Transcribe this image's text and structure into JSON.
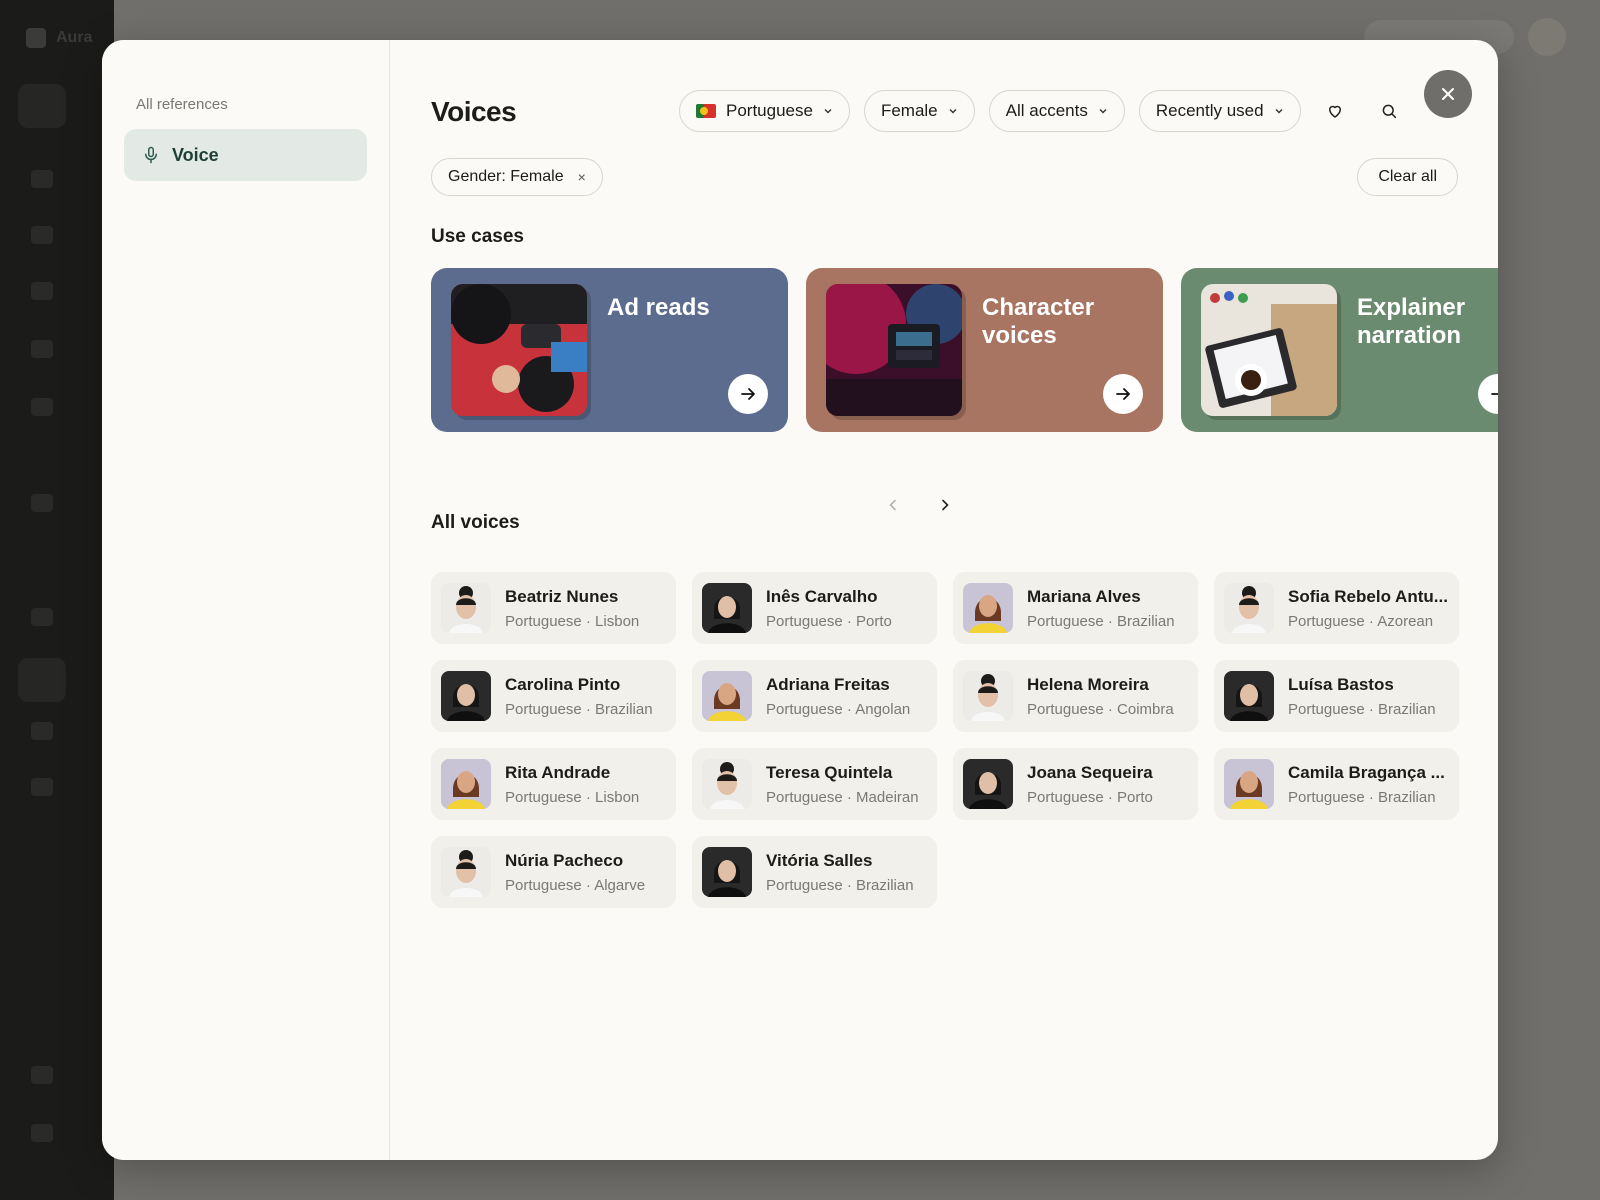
{
  "background": {
    "app_name": "Aura"
  },
  "sidebar": {
    "heading": "All references",
    "items": [
      {
        "label": "Voice",
        "icon": "microphone-icon"
      }
    ]
  },
  "header": {
    "title": "Voices",
    "filters": {
      "language": "Portuguese",
      "gender": "Female",
      "accent": "All accents",
      "sort": "Recently used"
    }
  },
  "chips": {
    "active": "Gender: Female",
    "remove_symbol": "×",
    "clear_all": "Clear all"
  },
  "use_cases": {
    "title": "Use cases",
    "cards": [
      {
        "label": "Ad reads"
      },
      {
        "label": "Character voices"
      },
      {
        "label": "Explainer narration"
      }
    ]
  },
  "all_voices": {
    "title": "All voices",
    "voices": [
      {
        "name": "Beatriz Nunes",
        "language": "Portuguese",
        "accent": "Lisbon",
        "meta": "Portuguese · Lisbon",
        "avatar": "light"
      },
      {
        "name": "Inês Carvalho",
        "language": "Portuguese",
        "accent": "Porto",
        "meta": "Portuguese · Porto",
        "avatar": "dark"
      },
      {
        "name": "Mariana Alves",
        "language": "Portuguese",
        "accent": "Brazilian",
        "meta": "Portuguese · Brazilian",
        "avatar": "yellow"
      },
      {
        "name": "Sofia Rebelo Antu...",
        "language": "Portuguese",
        "accent": "Azorean",
        "meta": "Portuguese · Azorean",
        "avatar": "light"
      },
      {
        "name": "Carolina Pinto",
        "language": "Portuguese",
        "accent": "Brazilian",
        "meta": "Portuguese · Brazilian",
        "avatar": "dark"
      },
      {
        "name": "Adriana Freitas",
        "language": "Portuguese",
        "accent": "Angolan",
        "meta": "Portuguese · Angolan",
        "avatar": "yellow"
      },
      {
        "name": "Helena Moreira",
        "language": "Portuguese",
        "accent": "Coimbra",
        "meta": "Portuguese · Coimbra",
        "avatar": "light"
      },
      {
        "name": "Luísa Bastos",
        "language": "Portuguese",
        "accent": "Brazilian",
        "meta": "Portuguese · Brazilian",
        "avatar": "dark"
      },
      {
        "name": "Rita Andrade",
        "language": "Portuguese",
        "accent": "Lisbon",
        "meta": "Portuguese · Lisbon",
        "avatar": "yellow"
      },
      {
        "name": "Teresa Quintela",
        "language": "Portuguese",
        "accent": "Madeiran",
        "meta": "Portuguese · Madeiran",
        "avatar": "light"
      },
      {
        "name": "Joana Sequeira",
        "language": "Portuguese",
        "accent": "Porto",
        "meta": "Portuguese · Porto",
        "avatar": "dark"
      },
      {
        "name": "Camila Bragança ...",
        "language": "Portuguese",
        "accent": "Brazilian",
        "meta": "Portuguese · Brazilian",
        "avatar": "yellow"
      },
      {
        "name": "Núria Pacheco",
        "language": "Portuguese",
        "accent": "Algarve",
        "meta": "Portuguese · Algarve",
        "avatar": "light"
      },
      {
        "name": "Vitória Salles",
        "language": "Portuguese",
        "accent": "Brazilian",
        "meta": "Portuguese · Brazilian",
        "avatar": "dark"
      }
    ]
  },
  "colors": {
    "ad_reads": "#5c6c8e",
    "character_voices": "#a87562",
    "explainer_narration": "#6a8b70",
    "sidebar_active": "#e3eae6",
    "accent_text": "#1d3f35"
  }
}
